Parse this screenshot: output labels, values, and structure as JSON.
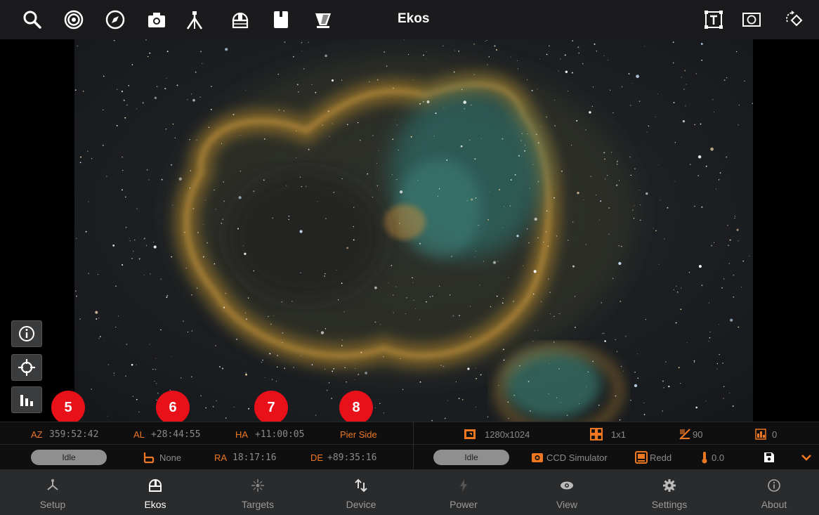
{
  "header": {
    "title": "Ekos",
    "tools_left": [
      "search-icon",
      "target-rings-icon",
      "compass-icon",
      "camera-icon",
      "telescope-mount-icon",
      "dome-icon",
      "filter-wheel-icon",
      "flat-panel-icon"
    ],
    "tools_right": [
      "text-frame-icon",
      "viewfinder-icon",
      "rotate-diamond-icon"
    ]
  },
  "markers": [
    "5",
    "6",
    "7",
    "8"
  ],
  "status_mount": {
    "az_label": "AZ",
    "az_value": "359:52:42",
    "al_label": "AL",
    "al_value": "+28:44:55",
    "ha_label": "HA",
    "ha_value": "+11:00:05",
    "pier_side": "Pier Side",
    "state": "Idle",
    "park_value": "None",
    "ra_label": "RA",
    "ra_value": "18:17:16",
    "de_label": "DE",
    "de_value": "+89:35:16"
  },
  "status_camera": {
    "resolution": "1280x1024",
    "binning": "1x1",
    "gain": "90",
    "offset": "0",
    "state": "Idle",
    "camera_name": "CCD Simulator",
    "filter": "Redd",
    "temperature": "0.0"
  },
  "nav": [
    {
      "label": "Setup",
      "icon": "setup-icon"
    },
    {
      "label": "Ekos",
      "icon": "ekos-icon",
      "active": true
    },
    {
      "label": "Targets",
      "icon": "targets-icon"
    },
    {
      "label": "Device",
      "icon": "device-icon"
    },
    {
      "label": "Power",
      "icon": "power-icon"
    },
    {
      "label": "View",
      "icon": "view-icon"
    },
    {
      "label": "Settings",
      "icon": "settings-icon"
    },
    {
      "label": "About",
      "icon": "about-icon"
    }
  ],
  "colors": {
    "accent": "#ee7722",
    "marker": "#e8111a",
    "toolbar_bg": "#1b1b1d",
    "nav_bg": "#2a2b2d"
  }
}
